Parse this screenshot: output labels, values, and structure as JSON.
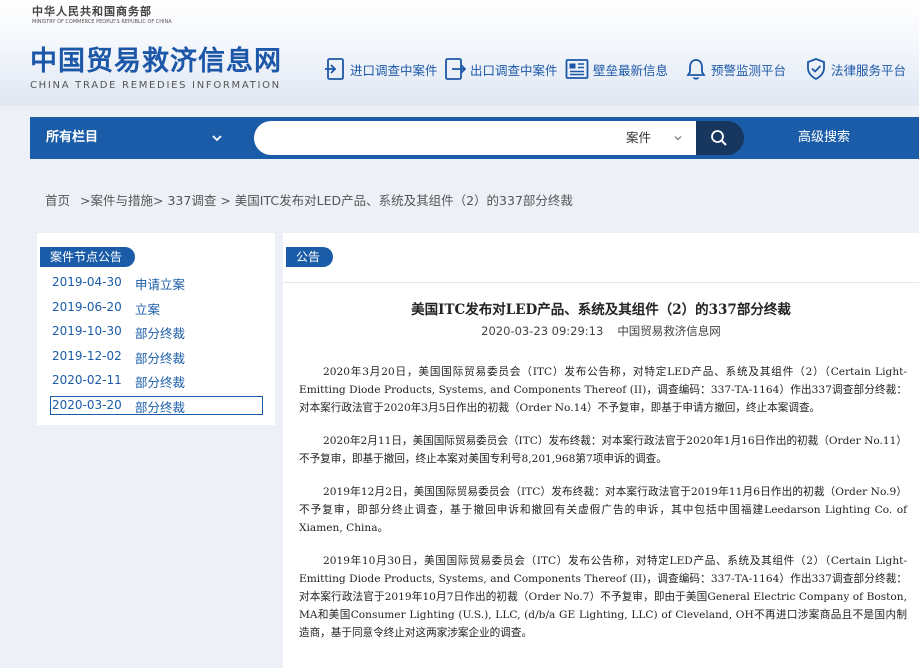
{
  "header": {
    "ministry_cn": "中华人民共和国商务部",
    "ministry_en": "MINISTRY OF COMMERCE PEOPLE'S REPUBLIC OF CHINA",
    "site_title_cn": "中国贸易救济信息网",
    "site_title_en": "CHINA TRADE REMEDIES INFORMATION",
    "nav": [
      {
        "label": "进口调查中案件",
        "icon": "document-in-icon"
      },
      {
        "label": "出口调查中案件",
        "icon": "document-out-icon"
      },
      {
        "label": "壁垒最新信息",
        "icon": "newspaper-icon"
      },
      {
        "label": "预警监测平台",
        "icon": "bell-icon"
      },
      {
        "label": "法律服务平台",
        "icon": "shield-check-icon"
      }
    ]
  },
  "search": {
    "all_categories": "所有栏目",
    "query": "",
    "type_selected": "案件",
    "advanced": "高级搜索"
  },
  "breadcrumb": {
    "home": "首页",
    "sep": ">",
    "level1": "案件与措施",
    "level2": "337调查",
    "current": "美国ITC发布对LED产品、系统及其组件（2）的337部分终裁"
  },
  "nodes": {
    "title": "案件节点公告",
    "items": [
      {
        "date": "2019-04-30",
        "label": "申请立案"
      },
      {
        "date": "2019-06-20",
        "label": "立案"
      },
      {
        "date": "2019-10-30",
        "label": "部分终裁"
      },
      {
        "date": "2019-12-02",
        "label": "部分终裁"
      },
      {
        "date": "2020-02-11",
        "label": "部分终裁"
      },
      {
        "date": "2020-03-20",
        "label": "部分终裁"
      }
    ],
    "active_index": 5
  },
  "article": {
    "section": "公告",
    "title": "美国ITC发布对LED产品、系统及其组件（2）的337部分终裁",
    "datetime": "2020-03-23 09:29:13",
    "source": "中国贸易救济信息网",
    "paragraphs": [
      "2020年3月20日，美国国际贸易委员会（ITC）发布公告称，对特定LED产品、系统及其组件（2）（Certain Light-Emitting Diode Products, Systems, and Components Thereof (II)，调查编码：337-TA-1164）作出337调查部分终裁：对本案行政法官于2020年3月5日作出的初裁（Order No.14）不予复审，即基于申请方撤回，终止本案调查。",
      "2020年2月11日，美国国际贸易委员会（ITC）发布终裁：对本案行政法官于2020年1月16日作出的初裁（Order No.11）不予复审，即基于撤回，终止本案对美国专利号8,201,968第7项申诉的调查。",
      "2019年12月2日，美国国际贸易委员会（ITC）发布终裁：对本案行政法官于2019年11月6日作出的初裁（Order No.9）不予复审，即部分终止调查，基于撤回申诉和撤回有关虚假广告的申诉，其中包括中国福建Leedarson Lighting Co. of Xiamen, China。",
      "2019年10月30日，美国国际贸易委员会（ITC）发布公告称，对特定LED产品、系统及其组件（2）（Certain Light-Emitting Diode Products, Systems, and Components Thereof (II)，调查编码：337-TA-1164）作出337调查部分终裁：对本案行政法官于2019年10月7日作出的初裁（Order No.7）不予复审，即由于美国General Electric Company of Boston, MA和美国Consumer Lighting (U.S.), LLC, (d/b/a GE Lighting, LLC) of Cleveland, OH不再进口涉案商品且不是国内制造商，基于同意令终止对这两家涉案企业的调查。"
    ]
  }
}
